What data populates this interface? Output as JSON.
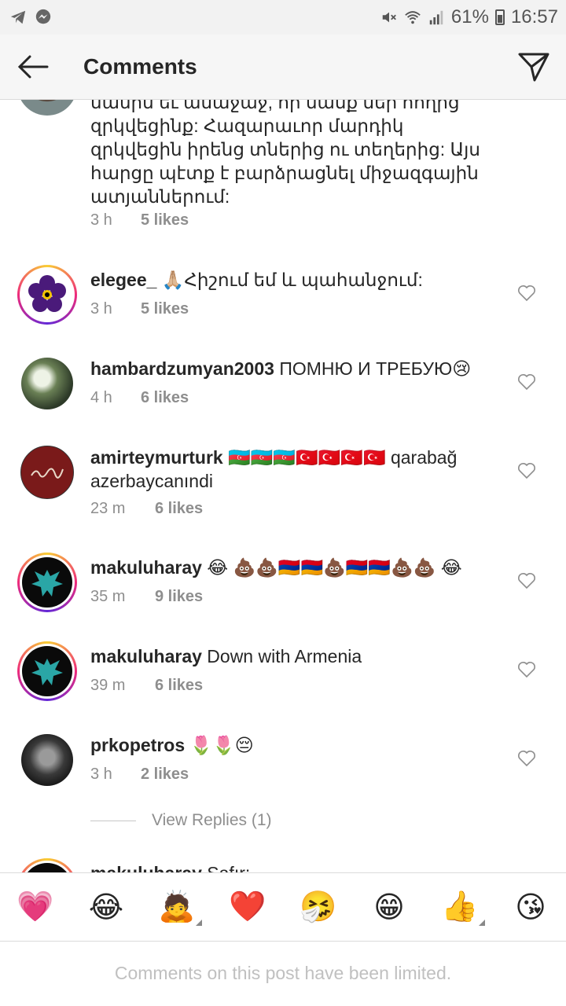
{
  "status_bar": {
    "battery": "61%",
    "time": "16:57",
    "icons": [
      "telegram-icon",
      "messenger-icon",
      "mute-icon",
      "wifi-icon",
      "signal-icon",
      "battery-icon"
    ]
  },
  "header": {
    "title": "Comments"
  },
  "comments": [
    {
      "username": "",
      "text": "մասիս եւ անաջաջ, որ մամք մեր հողից զրկվեցինք: Հազարաւոր մարդիկ զրկվեցին իրենց տներից ու տեղերից: Այս հարցը պէտք է բարձրացնել միջազգային ատյաններում:",
      "time": "3 h",
      "likes": "5 likes"
    },
    {
      "username": "elegee_",
      "text": " 🙏🏼Հիշում եմ և պահանջում:",
      "time": "3 h",
      "likes": "5 likes"
    },
    {
      "username": "hambardzumyan2003",
      "text": " ПОМНЮ И ТРЕБУЮ😢",
      "time": "4 h",
      "likes": "6 likes"
    },
    {
      "username": "amirteymurturk",
      "text": " 🇦🇿🇦🇿🇦🇿🇹🇷🇹🇷🇹🇷🇹🇷 qarabağ azerbaycanındi",
      "time": "23 m",
      "likes": "6 likes"
    },
    {
      "username": "makuluharay",
      "text": " 😂 💩💩🇦🇲🇦🇲💩🇦🇲🇦🇲💩💩 😂",
      "time": "35 m",
      "likes": "9 likes"
    },
    {
      "username": "makuluharay",
      "text": " Down with Armenia",
      "time": "39 m",
      "likes": "6 likes"
    },
    {
      "username": "prkopetros",
      "text": " 🌷🌷😔",
      "time": "3 h",
      "likes": "2 likes"
    },
    {
      "username": "makuluharay",
      "text": " Safır:",
      "time": "",
      "likes": ""
    }
  ],
  "view_replies": "View Replies (1)",
  "emoji_bar": [
    "💗",
    "😂",
    "🙇",
    "❤️",
    "🤧",
    "😁",
    "👍",
    "😘"
  ],
  "footer": {
    "limited_text": "Comments on this post have been limited."
  },
  "colors": {
    "text": "#262626",
    "meta": "#8e8e8e",
    "limited": "#c0c0c0"
  }
}
